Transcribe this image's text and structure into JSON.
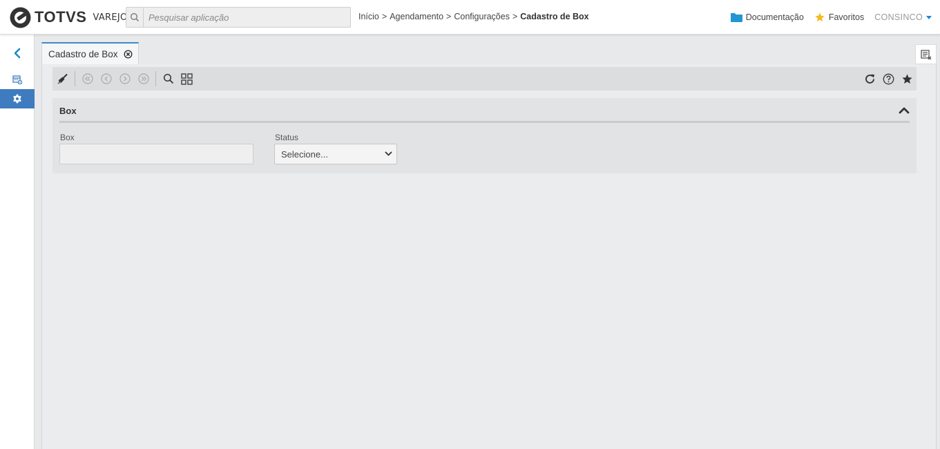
{
  "header": {
    "logo_text": "TOTVS",
    "logo_subtext": "VAREJO",
    "search_placeholder": "Pesquisar aplicação",
    "breadcrumb": {
      "items": [
        "Início",
        "Agendamento",
        "Configurações"
      ],
      "separator": ">",
      "current": "Cadastro de Box"
    },
    "documentation_label": "Documentação",
    "favorites_label": "Favoritos",
    "user_label": "CONSINCO"
  },
  "sidebar": {
    "items": [
      {
        "icon": "chevron-left-icon"
      },
      {
        "icon": "calendar-settings-icon"
      },
      {
        "icon": "gear-icon",
        "active": true
      }
    ]
  },
  "tabs": [
    {
      "label": "Cadastro de Box",
      "active": true
    }
  ],
  "toolbar": {
    "left_icons": [
      "clear-broom-icon",
      "first-record-icon",
      "previous-record-icon",
      "next-record-icon",
      "last-record-icon",
      "search-icon",
      "grid-view-icon"
    ],
    "right_icons": [
      "refresh-icon",
      "help-icon",
      "favorite-star-icon"
    ]
  },
  "form": {
    "section_title": "Box",
    "fields": {
      "box_label": "Box",
      "box_value": "",
      "status_label": "Status",
      "status_selected": "Selecione..."
    }
  },
  "colors": {
    "accent_blue": "#3e7bbf",
    "link_blue": "#1e88c8",
    "star_yellow": "#f5b922",
    "folder_blue": "#2196d3"
  }
}
